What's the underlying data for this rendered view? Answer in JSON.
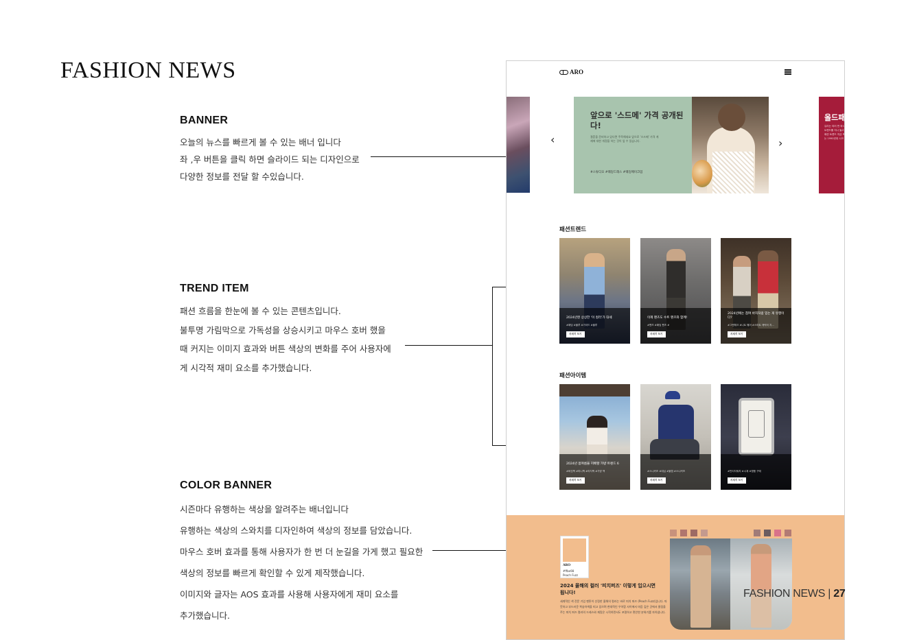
{
  "page_title": "FASHION NEWS",
  "annotations": {
    "banner": {
      "heading": "BANNER",
      "lines": [
        "오늘의 뉴스를 빠르게 볼 수 있는 배너 입니다",
        "좌 ,우 버튼을 클릭 하면 슬라이드 되는 디자인으로",
        "다양한 정보를 전달 할 수있습니다."
      ]
    },
    "trend": {
      "heading": "TREND ITEM",
      "lines": [
        "패션 흐름을 한눈에 볼 수 있는 콘텐츠입니다.",
        "불투명 가림막으로 가독성을 상승시키고 마우스 호버 했을",
        "때 커지는 이미지 효과와 버튼 색상의 변화를 주어 사용자에",
        "게 시각적 재미 요소를 추가했습니다."
      ]
    },
    "color_banner": {
      "heading": "COLOR BANNER",
      "lines": [
        "시즌마다 유행하는 색상을 알려주는 배너입니다",
        "유행하는 색상의 스와치를 디자인하여 색상의 정보를 담았습니다.",
        "마우스 호버 효과를 통해 사용자가 한 번 더 눈길을 가게 했고 필요한",
        "색상의 정보를 빠르게 확인할 수 있게 제작했습니다.",
        "이미지와 글자는 AOS 효과를 사용해 사용자에게 재미 요소를",
        "추가했습니다."
      ]
    }
  },
  "mockup": {
    "logo": "ARO",
    "menu_icon": "hamburger-icon",
    "banner": {
      "title": "앞으로 '스드메' 가격 공개된다!",
      "subtitle": "결혼을 준비하고 있다면 주목해세요 앞으로 '스드메' 가격 게재에 대한 개정을 하는 것이 앞 수 있습니다.",
      "tags": "#스튜디오 #웨딩드레스 #웨딩메이크업",
      "prev_icon": "chevron-left-icon",
      "next_icon": "chevron-right-icon",
      "next_slide_title": "올드패",
      "next_slide_text": "유리는 여러 번 와서 Y2K 트렌드를 지나 돌고 도는 패션 트렌드 지금 또 대세는 1990년대 시크"
    },
    "trend": {
      "title": "패션트렌드",
      "items": [
        {
          "title": "2024년엔 상상한 '이 컬러'가 대세",
          "tags": "#패딩 #블루 #가이드 #블루",
          "button": "자세히 보기"
        },
        {
          "title": "이제 팬츠도 수트 팬츠와 함께!",
          "tags": "#팬츠 #패딩 팬츠 #",
          "button": "자세히 보기"
        },
        {
          "title": "2024년에는 참여 바지처럼 입는 게 유행이다?",
          "tags": "#그렌체크 #니트 웨어 #스마트 캐릭터 지...",
          "button": "자세히 보기"
        }
      ]
    },
    "items": {
      "title": "패션아이템",
      "items": [
        {
          "title": "2024년 봄여름을 지배할 가방 트렌드 6",
          "tags": "#버킷백 #미니백 #라지백 #가방 백",
          "button": "자세히 보기"
        },
        {
          "title": "",
          "tags": "#스니커즈 #데님 #볼캡 #스니커즈",
          "button": "자세히 보기"
        },
        {
          "title": "",
          "tags": "#빈티지워치 #시계 #명품 구매",
          "button": "자세히 보기"
        }
      ]
    },
    "color": {
      "swatch_logo": "ARO",
      "swatch_code": "#ffbe98",
      "swatch_name": "Peach Fuzz",
      "title": "2024 올해의 컬러 '피치퍼즈' 이렇게 입으시면 됩니다!",
      "desc": "세계적인 색 전문 기업 팬톤이 선정한 올해의 컬러는 바로 피치 퍼즈 (Peach Fuzz)입니다. 따뜻하고 부드러운 복숭아색을 띠고 있으며 현대적인 우아함 사이에서 마음 깊은 곳에서 울림을 주는 피치 퍼즈 컬러의 드레스와 재킷은 시작하면서도 포멀하고 편안한 분위기를 자아냅니다.",
      "mini_swatches_left": [
        "#c8927c",
        "#b0766e",
        "#9d6a64",
        "#c49a8e"
      ],
      "mini_swatches_right": [
        "#a07b78",
        "#6b5c60",
        "#d8728a",
        "#b27a74"
      ]
    }
  },
  "page_number": {
    "label": "FASHION NEWS | ",
    "num": "27"
  },
  "colors": {
    "banner_green": "#a8c4ae",
    "banner_red": "#a51c3a",
    "peach": "#f2bd8d"
  }
}
